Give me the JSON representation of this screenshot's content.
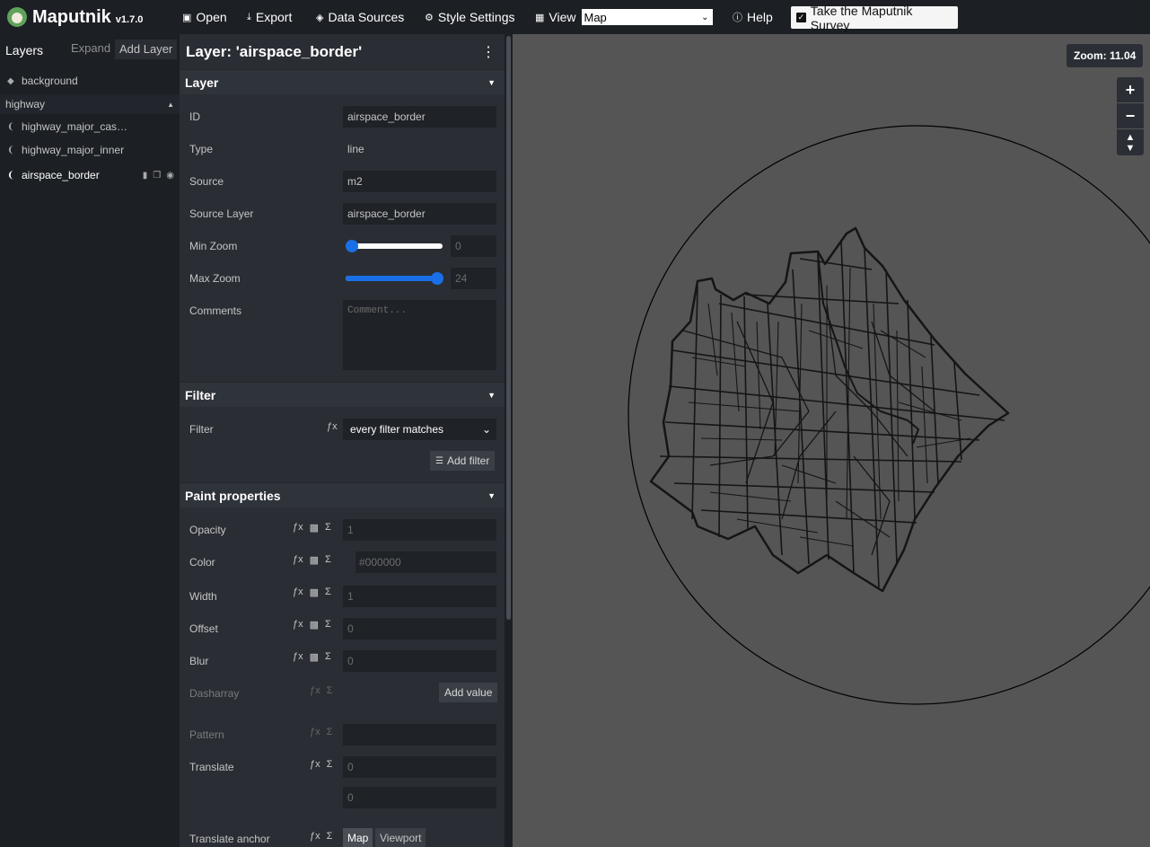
{
  "app": {
    "name": "Maputnik",
    "version": "v1.7.0"
  },
  "toolbar": {
    "open": "Open",
    "export": "Export",
    "data_sources": "Data Sources",
    "style_settings": "Style Settings",
    "view": "View",
    "view_value": "Map",
    "help": "Help",
    "survey": "Take the Maputnik Survey"
  },
  "layers_panel": {
    "title": "Layers",
    "expand": "Expand",
    "add_layer": "Add Layer",
    "items": [
      {
        "label": "background",
        "icon": "fill-diamond-icon"
      },
      {
        "label": "highway",
        "group": true
      },
      {
        "label": "highway_major_cas…",
        "icon": "line-icon"
      },
      {
        "label": "highway_major_inner",
        "icon": "line-icon"
      },
      {
        "label": "airspace_border",
        "icon": "line-icon",
        "selected": true
      }
    ]
  },
  "editor": {
    "title": "Layer: 'airspace_border'",
    "layer_section": {
      "title": "Layer",
      "id_label": "ID",
      "id_value": "airspace_border",
      "type_label": "Type",
      "type_value": "line",
      "source_label": "Source",
      "source_value": "m2",
      "source_layer_label": "Source Layer",
      "source_layer_value": "airspace_border",
      "min_zoom_label": "Min Zoom",
      "min_zoom_value": "0",
      "max_zoom_label": "Max Zoom",
      "max_zoom_value": "24",
      "comments_label": "Comments",
      "comments_placeholder": "Comment..."
    },
    "filter_section": {
      "title": "Filter",
      "filter_label": "Filter",
      "filter_value": "every filter matches",
      "add_filter": "Add filter"
    },
    "paint_section": {
      "title": "Paint properties",
      "opacity_label": "Opacity",
      "opacity_placeholder": "1",
      "color_label": "Color",
      "color_placeholder": "#000000",
      "width_label": "Width",
      "width_placeholder": "1",
      "offset_label": "Offset",
      "offset_placeholder": "0",
      "blur_label": "Blur",
      "blur_placeholder": "0",
      "dasharray_label": "Dasharray",
      "add_value": "Add value",
      "pattern_label": "Pattern",
      "translate_label": "Translate",
      "translate_x": "0",
      "translate_y": "0",
      "translate_anchor_label": "Translate anchor",
      "anchor_map": "Map",
      "anchor_viewport": "Viewport"
    }
  },
  "map": {
    "zoom_label": "Zoom: 11.04",
    "background_color": "#555555",
    "line_color": "#000000"
  }
}
